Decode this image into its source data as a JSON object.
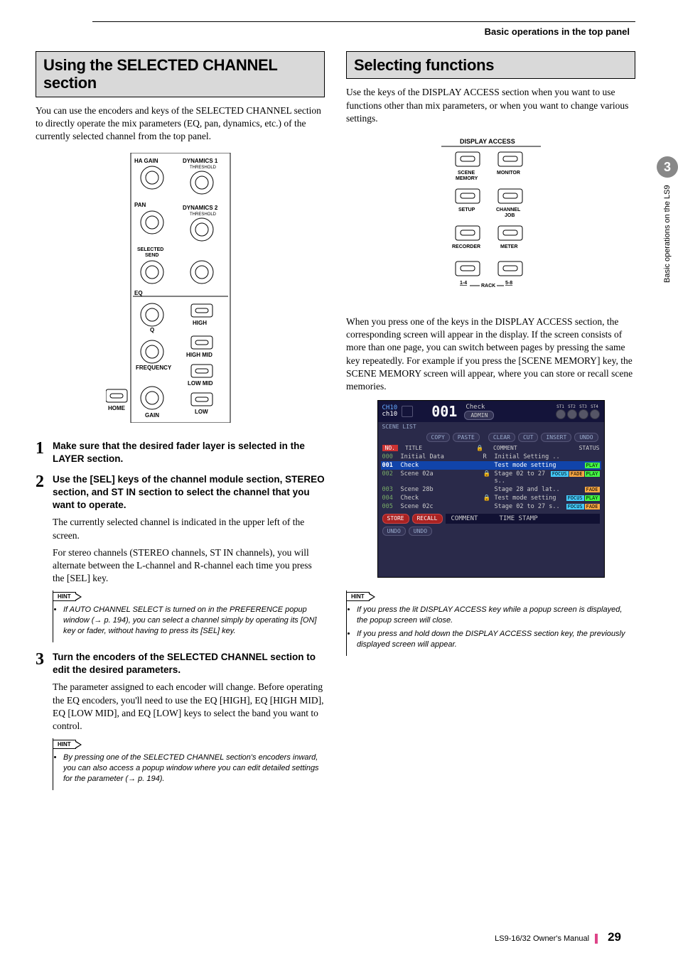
{
  "header": {
    "section": "Basic operations in the top panel"
  },
  "chapter_tab": {
    "number": "3",
    "label": "Basic operations on the LS9"
  },
  "left": {
    "title": "Using the SELECTED CHANNEL section",
    "intro": "You can use the encoders and keys of the SELECTED CHANNEL section to directly operate the mix parameters (EQ, pan, dynamics, etc.) of the currently selected channel from the top panel.",
    "panel_labels": {
      "ha_gain": "HA GAIN",
      "dyn1": "DYNAMICS 1",
      "dyn1_sub": "THRESHOLD",
      "pan": "PAN",
      "dyn2": "DYNAMICS 2",
      "dyn2_sub": "THRESHOLD",
      "sel_send": "SELECTED SEND",
      "eq": "EQ",
      "q": "Q",
      "high": "HIGH",
      "high_mid": "HIGH MID",
      "freq": "FREQUENCY",
      "low_mid": "LOW MID",
      "home": "HOME",
      "gain": "GAIN",
      "low": "LOW"
    },
    "steps": [
      {
        "n": "1",
        "head": "Make sure that the desired fader layer is selected in the LAYER section."
      },
      {
        "n": "2",
        "head": "Use the [SEL] keys of the channel module section, STEREO section, and ST IN section to select the channel that you want to operate.",
        "desc1": "The currently selected channel is indicated in the upper left of the screen.",
        "desc2": "For stereo channels (STEREO channels, ST IN channels), you will alternate between the L-channel and R-channel each time you press the [SEL] key.",
        "hint": "If AUTO CHANNEL SELECT is turned on in the PREFERENCE popup window (→ p. 194), you can select a channel simply by operating its [ON] key or fader, without having to press its [SEL] key."
      },
      {
        "n": "3",
        "head": "Turn the encoders of the SELECTED CHANNEL section to edit the desired parameters.",
        "desc1": "The parameter assigned to each encoder will change. Before operating the EQ encoders, you'll need to use the EQ [HIGH], EQ [HIGH MID], EQ [LOW MID], and EQ [LOW] keys to select the band you want to control.",
        "hint": "By pressing one of the SELECTED CHANNEL section's encoders inward, you can also access a popup window where you can edit detailed settings for the parameter (→ p. 194)."
      }
    ]
  },
  "right": {
    "title": "Selecting functions",
    "intro": "Use the keys of the DISPLAY ACCESS section when you want to use functions other than mix parameters, or when you want to change various settings.",
    "panel_labels": {
      "title": "DISPLAY ACCESS",
      "scene": "SCENE MEMORY",
      "monitor": "MONITOR",
      "setup": "SETUP",
      "channel": "CHANNEL JOB",
      "recorder": "RECORDER",
      "meter": "METER",
      "rack": "RACK",
      "l14": "1-4",
      "l58": "5-8"
    },
    "para2": "When you press one of the keys in the DISPLAY ACCESS section, the corresponding screen will appear in the display. If the screen consists of more than one page, you can switch between pages by pressing the same key repeatedly. For example if you press the [SCENE MEMORY] key, the SCENE MEMORY screen will appear, where you can store or recall scene memories.",
    "screen": {
      "ch": "CH10",
      "ch2": "ch10",
      "num": "001",
      "check": "Check",
      "admin": "ADMIN",
      "st": [
        "ST1",
        "ST2",
        "ST3",
        "ST4"
      ],
      "scene_list": "SCENE LIST",
      "row_btns1": [
        "COPY",
        "PASTE"
      ],
      "row_btns2": [
        "CLEAR",
        "CUT",
        "INSERT",
        "UNDO"
      ],
      "hdr": [
        "NO.",
        "TITLE",
        "COMMENT",
        "STATUS"
      ],
      "rows": [
        {
          "n": "000",
          "t": "Initial Data",
          "c": "Initial Setting ..",
          "tags": [],
          "lock": "R"
        },
        {
          "n": "001",
          "t": "Check",
          "c": "Test mode setting",
          "tags": [
            "PLAY"
          ],
          "sel": true
        },
        {
          "n": "002",
          "t": "Scene 02a",
          "c": "Stage 02 to 27 s..",
          "tags": [
            "FOCUS",
            "FADE",
            "PLAY"
          ],
          "lock": "🔒"
        },
        {
          "n": "003",
          "t": "Scene 28b",
          "c": "Stage 28 and lat..",
          "tags": [
            "FADE"
          ]
        },
        {
          "n": "004",
          "t": "Check",
          "c": "Test mode setting",
          "tags": [
            "FOCUS",
            "PLAY"
          ],
          "lock": "🔒"
        },
        {
          "n": "005",
          "t": "Scene 02c",
          "c": "Stage 02 to 27 s..",
          "tags": [
            "FOCUS",
            "FADE"
          ]
        }
      ],
      "bot": [
        "STORE",
        "RECALL",
        "COMMENT",
        "TIME STAMP",
        "UNDO",
        "UNDO"
      ]
    },
    "hints": [
      "If you press the lit DISPLAY ACCESS key while a popup screen is displayed, the popup screen will close.",
      "If you press and hold down the DISPLAY ACCESS section key, the previously displayed screen will appear."
    ]
  },
  "footer": {
    "manual": "LS9-16/32  Owner's Manual",
    "page": "29"
  },
  "hint_label": "HINT"
}
